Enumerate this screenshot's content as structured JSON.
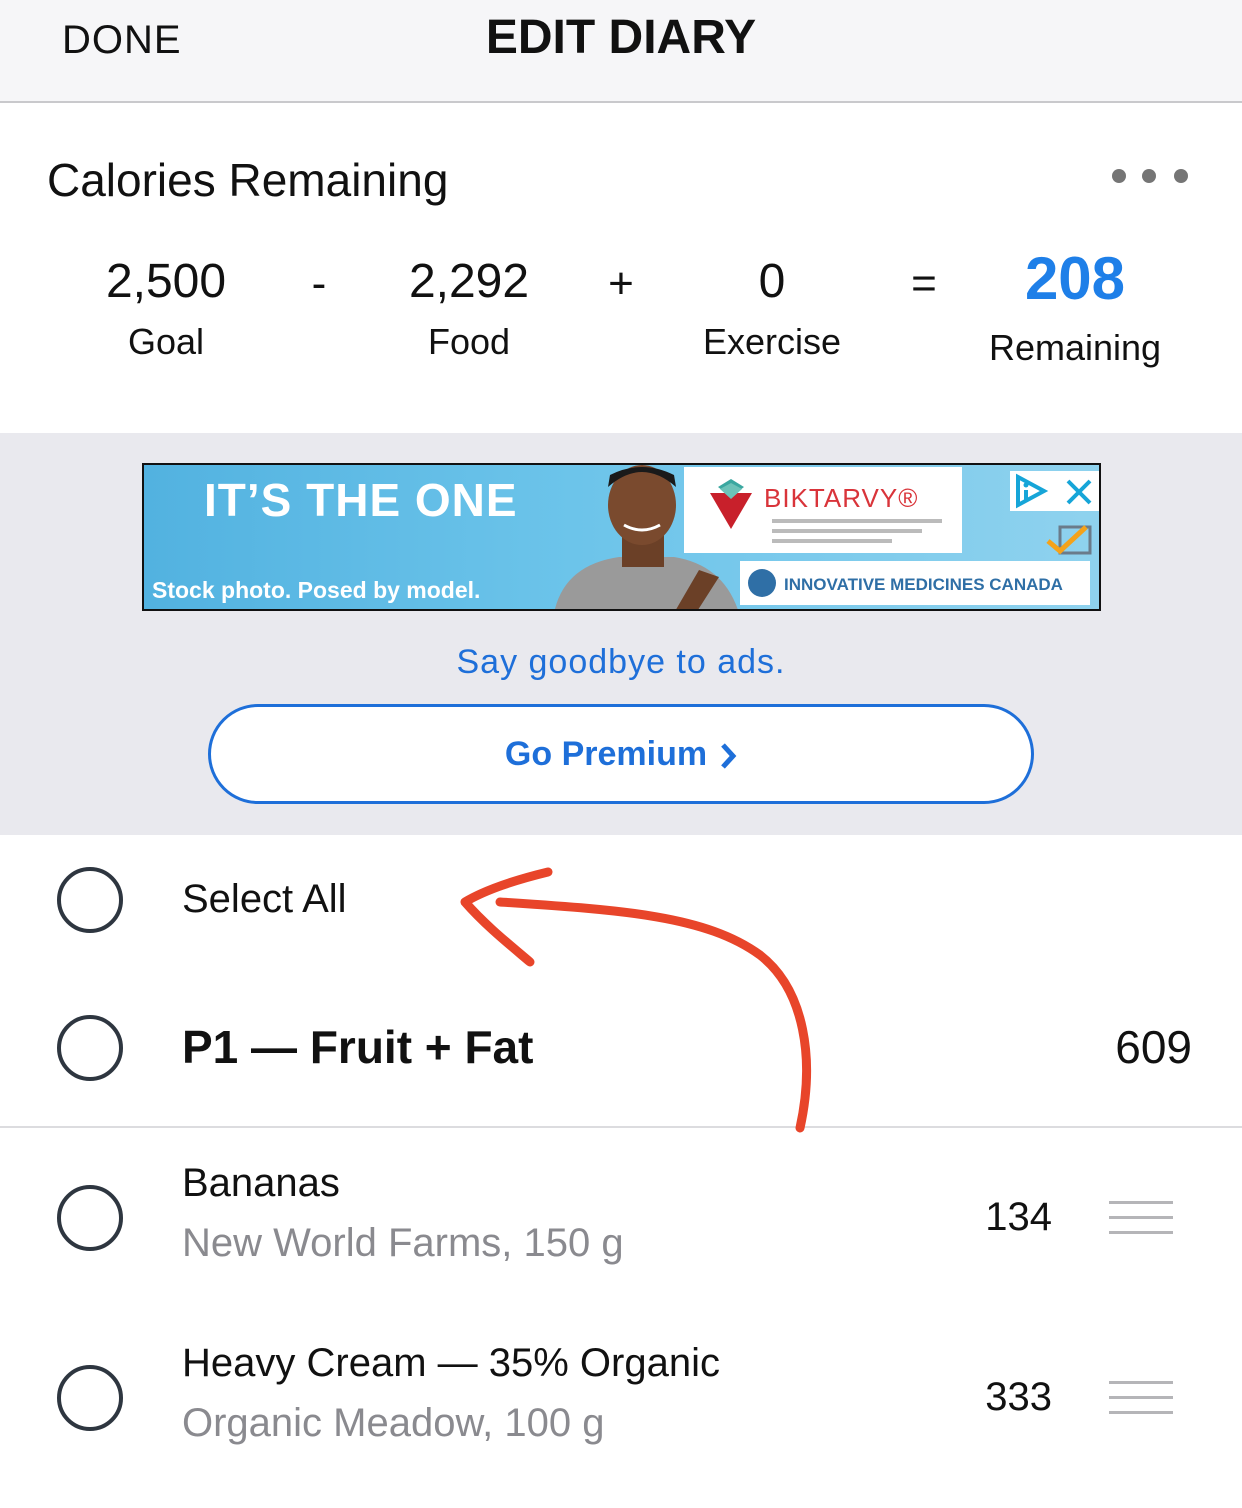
{
  "header": {
    "done_label": "DONE",
    "title": "EDIT DIARY"
  },
  "calories": {
    "title": "Calories Remaining",
    "goal_value": "2,500",
    "goal_label": "Goal",
    "food_value": "2,292",
    "food_label": "Food",
    "exercise_value": "0",
    "exercise_label": "Exercise",
    "remaining_value": "208",
    "remaining_label": "Remaining",
    "op_minus": "-",
    "op_plus": "+",
    "op_equals": "=",
    "accent_color": "#1e7fe8"
  },
  "ad": {
    "headline": "IT’S THE ONE",
    "disclaimer": "Stock photo. Posed by model.",
    "brand": "BIKTARVY®",
    "member": "INNOVATIVE MEDICINES CANADA",
    "goodbye_link": "Say goodbye to ads.",
    "premium_button": "Go Premium",
    "link_color": "#1e6fd9"
  },
  "list": {
    "select_all_label": "Select All",
    "meal": {
      "name": "P1 — Fruit + Fat",
      "calories": "609"
    },
    "items": [
      {
        "name": "Bananas",
        "detail": "New World Farms, 150 g",
        "calories": "134"
      },
      {
        "name": "Heavy Cream — 35% Organic",
        "detail": "Organic Meadow, 100 g",
        "calories": "333"
      }
    ]
  },
  "annotation": {
    "arrow_color": "#e8452a"
  }
}
